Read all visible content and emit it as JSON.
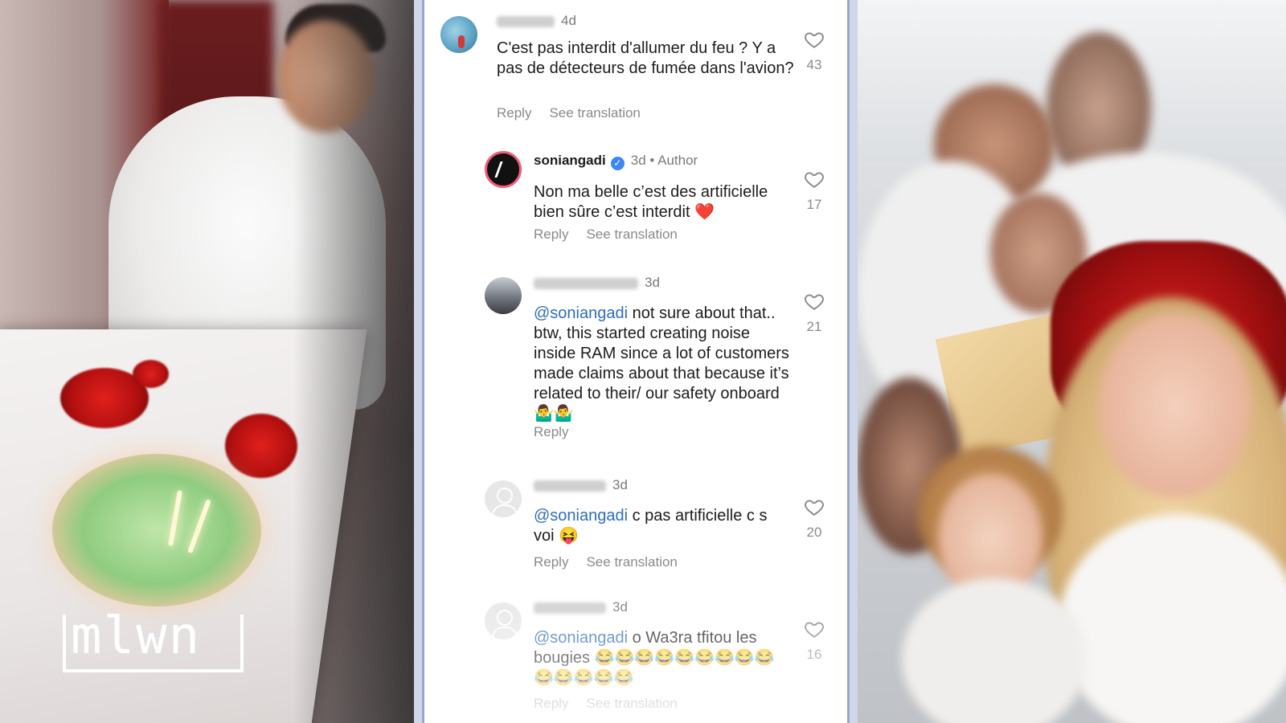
{
  "logo": {
    "text": "mlwn"
  },
  "comments": [
    {
      "username": "",
      "time": "4d",
      "author_badge": "",
      "text": "C'est pas interdit d'allumer du feu ? Y a pas de détecteurs de fumée dans l'avion?",
      "mention": "",
      "actions": {
        "reply": "Reply",
        "translate": "See translation"
      },
      "likes": "43"
    },
    {
      "username": "soniangadi",
      "time": "3d",
      "author_badge": "• Author",
      "text": "Non ma belle c’est des artificielle bien sûre c’est interdit ❤️",
      "mention": "",
      "actions": {
        "reply": "Reply",
        "translate": "See translation"
      },
      "likes": "17"
    },
    {
      "username": "",
      "time": "3d",
      "author_badge": "",
      "mention": "@soniangadi",
      "text": " not sure about that.. btw, this started creating noise inside RAM since a lot of customers made claims about that because it’s related to their/ our safety onboard 🤷‍♂️🤷‍♂️",
      "actions": {
        "reply": "Reply",
        "translate": ""
      },
      "likes": "21"
    },
    {
      "username": "",
      "time": "3d",
      "author_badge": "",
      "mention": "@soniangadi",
      "text": " c pas artificielle c s voi 😝",
      "actions": {
        "reply": "Reply",
        "translate": "See translation"
      },
      "likes": "20"
    },
    {
      "username": "",
      "time": "3d",
      "author_badge": "",
      "mention": "@soniangadi",
      "text": " o Wa3ra tfitou les bougies 😂😂😂😂😂😂😂😂😂😂😂😂😂😂",
      "actions": {
        "reply": "Reply",
        "translate": "See translation"
      },
      "likes": "16"
    }
  ],
  "icons": {
    "heart": "heart-outline-icon",
    "verified": "verified-badge-icon"
  },
  "colors": {
    "mention": "#2f6db5",
    "verified": "#3b88f5",
    "heart_emoji": "#e02424"
  }
}
